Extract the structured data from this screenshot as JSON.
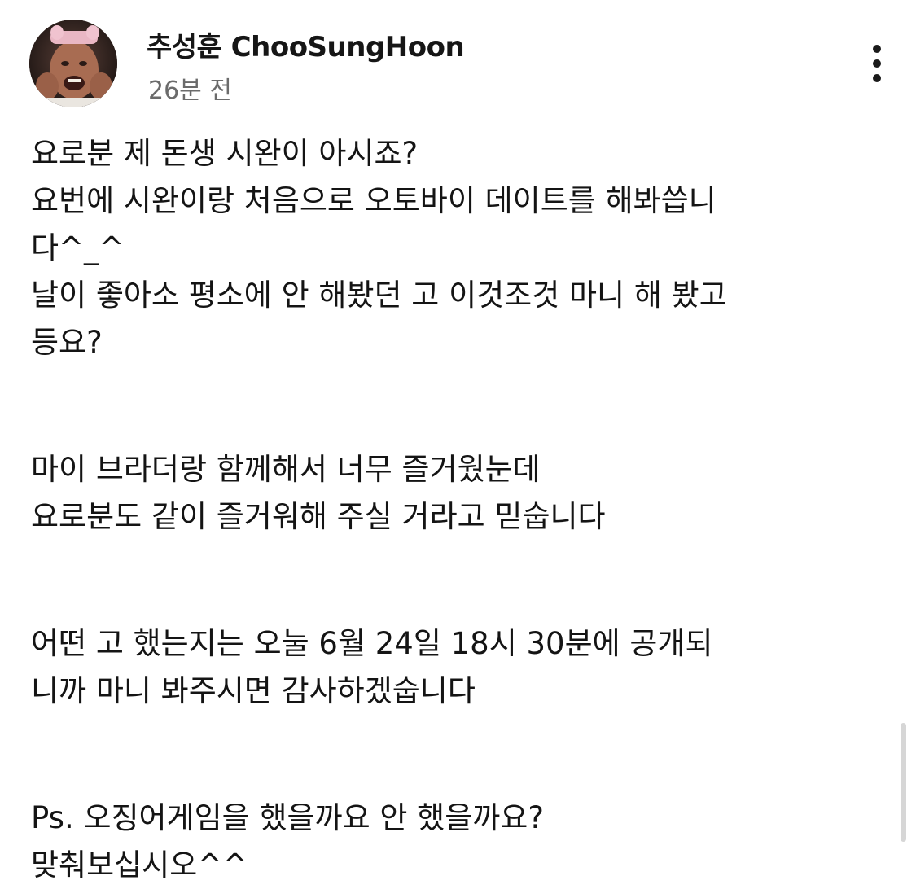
{
  "post": {
    "author": "추성훈 ChooSungHoon",
    "time": "26분 전",
    "body": {
      "p1": {
        "l1": "요로분 제 돈생 시완이 아시죠?",
        "l2": "요번에 시완이랑 처음으로 오토바이 데이트를 해봐씁니",
        "l3": "다^_^",
        "l4": "날이 좋아소 평소에 안 해봤던 고 이것조것 마니 해 봤고",
        "l5": "등요?"
      },
      "p2": {
        "l1": "마이 브라더랑 함께해서 너무 즐거웠눈데",
        "l2": "요로분도 같이 즐거워해 주실 거라고 믿숩니다"
      },
      "p3": {
        "l1": "어떤 고 했는지는 오눌 6월 24일 18시 30분에 공개되",
        "l2": "니까 마니 봐주시면 감사하겠숩니다"
      },
      "p4": {
        "l1": "Ps. 오징어게임을 했을까요 안 했을까요?",
        "l2": "맞춰보십시오^^"
      }
    }
  },
  "icons": {
    "more": "more-vertical-icon",
    "avatar": "profile-photo"
  },
  "colors": {
    "text": "#141414",
    "secondary": "#6b6b6b",
    "background": "#ffffff"
  }
}
